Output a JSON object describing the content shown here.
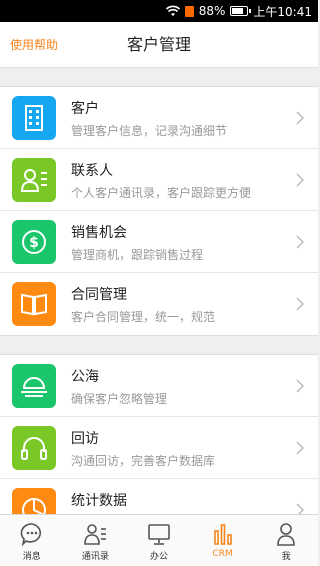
{
  "status_bar": {
    "battery_percent": "88%",
    "time": "上午10:41",
    "battery_level": 0.88
  },
  "header": {
    "help_label": "使用帮助",
    "title": "客户管理"
  },
  "colors": {
    "accent": "#f5861f",
    "blue": "#17a6f0",
    "green": "#7ac828",
    "bright_green": "#1bc56b",
    "orange": "#ff8a12"
  },
  "groups": [
    {
      "items": [
        {
          "icon": "building-icon",
          "title": "客户",
          "subtitle": "管理客户信息，记录沟通细节"
        },
        {
          "icon": "contact-card-icon",
          "title": "联系人",
          "subtitle": "个人客户通讯录，客户跟踪更方便"
        },
        {
          "icon": "dollar-circle-icon",
          "title": "销售机会",
          "subtitle": "管理商机，跟踪销售过程"
        },
        {
          "icon": "book-icon",
          "title": "合同管理",
          "subtitle": "客户合同管理，统一，规范"
        }
      ]
    },
    {
      "items": [
        {
          "icon": "sea-sunrise-icon",
          "title": "公海",
          "subtitle": "确保客户忽略管理"
        },
        {
          "icon": "headset-icon",
          "title": "回访",
          "subtitle": "沟通回访，完善客户数据库"
        },
        {
          "icon": "pie-chart-icon",
          "title": "统计数据",
          "subtitle": ""
        }
      ]
    }
  ],
  "tabbar": {
    "tabs": [
      {
        "label": "消息",
        "icon": "chat-bubble-icon"
      },
      {
        "label": "通讯录",
        "icon": "contacts-icon"
      },
      {
        "label": "办公",
        "icon": "monitor-icon"
      },
      {
        "label": "CRM",
        "icon": "crm-bars-icon",
        "active": true
      },
      {
        "label": "我",
        "icon": "person-icon"
      }
    ]
  }
}
